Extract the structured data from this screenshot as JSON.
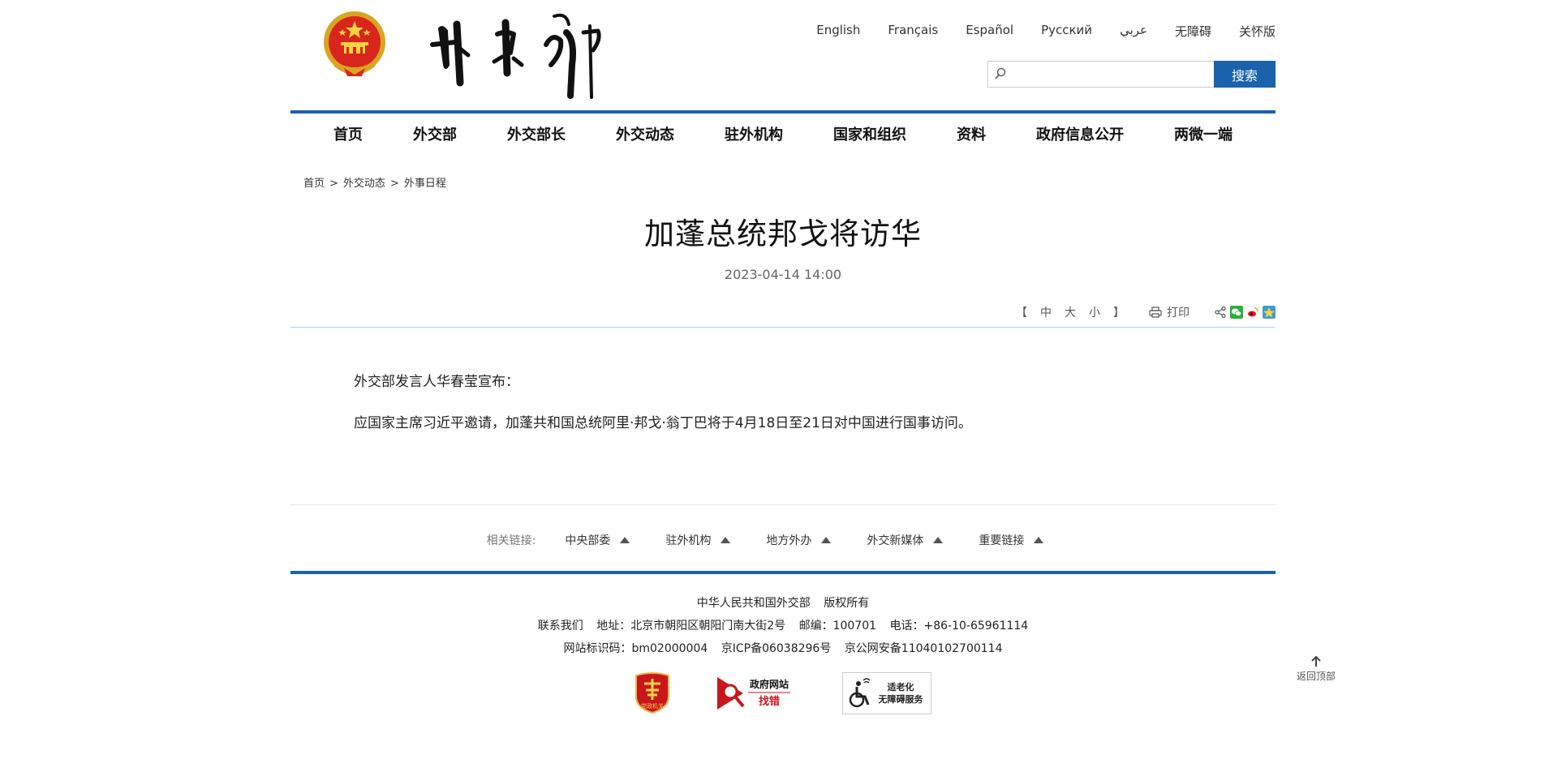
{
  "header": {
    "languages": [
      "English",
      "Français",
      "Español",
      "Русский",
      "عربي",
      "无障碍",
      "关怀版"
    ],
    "search": {
      "placeholder": "",
      "button_label": "搜索"
    }
  },
  "nav": [
    "首页",
    "外交部",
    "外交部长",
    "外交动态",
    "驻外机构",
    "国家和组织",
    "资料",
    "政府信息公开",
    "两微一端"
  ],
  "breadcrumb": {
    "items": [
      "首页",
      "外交动态",
      "外事日程"
    ],
    "separator": ">"
  },
  "article": {
    "title": "加蓬总统邦戈将访华",
    "date": "2023-04-14 14:00",
    "paragraphs": [
      "外交部发言人华春莹宣布：",
      "应国家主席习近平邀请，加蓬共和国总统阿里·邦戈·翁丁巴将于4月18日至21日对中国进行国事访问。"
    ]
  },
  "tools": {
    "bracket_open": "【",
    "sizes": [
      "中",
      "大",
      "小"
    ],
    "bracket_close": "】",
    "print_label": "打印"
  },
  "related": {
    "label": "相关链接:",
    "links": [
      "中央部委",
      "驻外机构",
      "地方外办",
      "外交新媒体",
      "重要链接"
    ]
  },
  "footer": {
    "line1": [
      "中华人民共和国外交部",
      "版权所有"
    ],
    "line2": [
      "联系我们",
      "地址：北京市朝阳区朝阳门南大街2号",
      "邮编：100701",
      "电话：+86-10-65961114"
    ],
    "line3": [
      "网站标识码：bm02000004",
      "京ICP备06038296号",
      "京公网安备11040102700114"
    ],
    "badges": {
      "party": "党政机关",
      "gov_title": "政府网站",
      "gov_sub": "找错",
      "access_line1": "适老化",
      "access_line2": "无障碍服务"
    }
  },
  "back_to_top": "返回顶部",
  "colors": {
    "brand_blue": "#1a62ab",
    "divider_light": "#b8d2ea",
    "badge_red": "#c8161d"
  }
}
